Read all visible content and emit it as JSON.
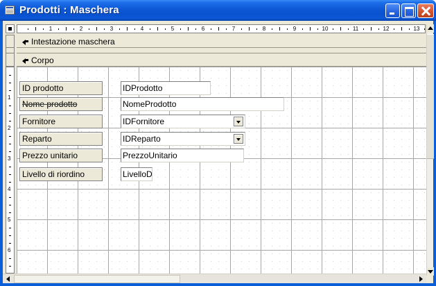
{
  "window": {
    "title": "Prodotti : Maschera",
    "buttons": [
      "minimize",
      "maximize",
      "close"
    ]
  },
  "ruler": {
    "h_numbers": [
      "1",
      "2",
      "3",
      "4",
      "5",
      "6",
      "7",
      "8",
      "9",
      "10",
      "11",
      "12",
      "13"
    ],
    "v_numbers": [
      "1",
      "2",
      "3",
      "4",
      "5",
      "6"
    ]
  },
  "sections": {
    "header": "Intestazione maschera",
    "body": "Corpo"
  },
  "fields": [
    {
      "label": "ID prodotto",
      "value": "IDProdotto",
      "type": "text"
    },
    {
      "label": "Nome prodotto",
      "value": "NomeProdotto",
      "type": "text"
    },
    {
      "label": "Fornitore",
      "value": "IDFornitore",
      "type": "combo"
    },
    {
      "label": "Reparto",
      "value": "IDReparto",
      "type": "combo"
    },
    {
      "label": "Prezzo unitario",
      "value": "PrezzoUnitario",
      "type": "text"
    },
    {
      "label": "Livello di riordino",
      "value": "LivelloD",
      "type": "text"
    }
  ],
  "colors": {
    "titlebar": "#0a52cf",
    "close_button": "#d2512d",
    "face": "#ece9d8",
    "grid_line": "#a6a6a6"
  },
  "icons": [
    "form-window-icon",
    "section-selector-icon",
    "dropdown-arrow-icon",
    "scroll-arrow-icon"
  ]
}
